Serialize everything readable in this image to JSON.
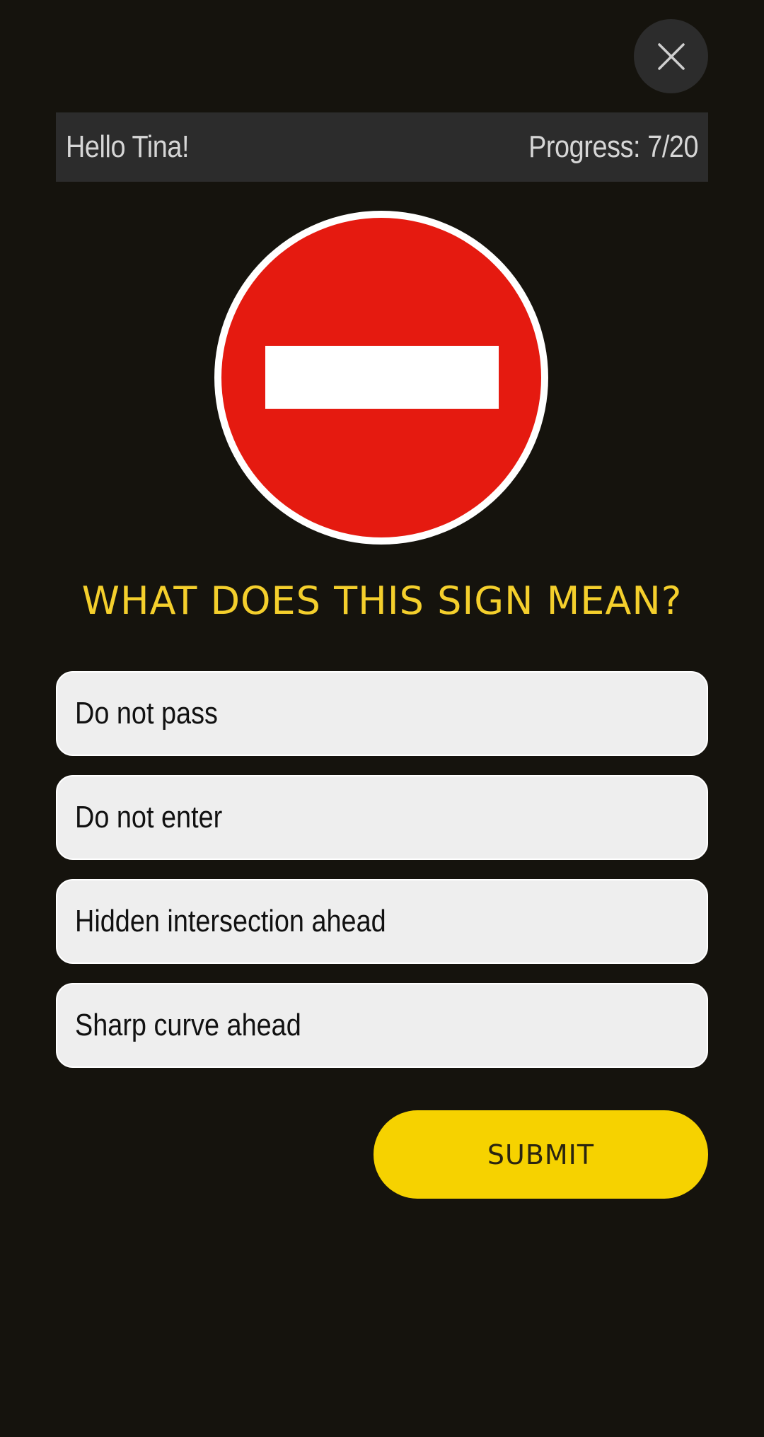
{
  "header": {
    "greeting": "Hello Tina!",
    "progress": "Progress: 7/20"
  },
  "close_button": {
    "icon": "close-icon"
  },
  "sign": {
    "type": "no-entry",
    "colors": {
      "disc": "#e51a10",
      "border": "#ffffff",
      "bar": "#ffffff"
    }
  },
  "question": "WHAT DOES THIS SIGN MEAN?",
  "options": [
    {
      "label": "Do not pass"
    },
    {
      "label": "Do not enter"
    },
    {
      "label": "Hidden intersection ahead"
    },
    {
      "label": "Sharp curve ahead"
    }
  ],
  "submit_label": "SUBMIT",
  "colors": {
    "background": "#15130d",
    "accent": "#f6d200",
    "question_text": "#f4cf2c",
    "option_bg": "#eeeeee",
    "header_bg": "#2c2c2c"
  }
}
